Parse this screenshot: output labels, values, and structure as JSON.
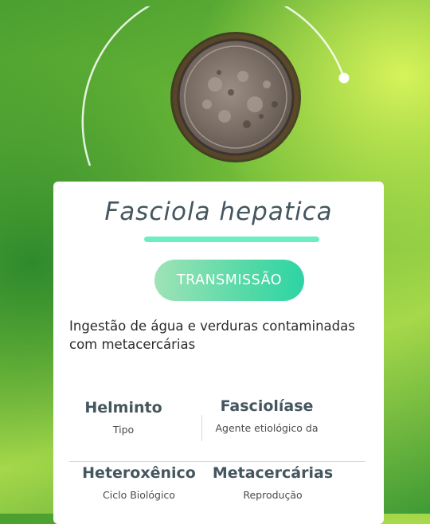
{
  "specimen": {
    "image": "fasciola-egg-micrograph"
  },
  "card": {
    "title": "Fasciola hepatica",
    "button_label": "TRANSMISSÃO",
    "description": "Ingestão de água e verduras contaminadas com metacercárias",
    "stats": [
      {
        "value": "Helminto",
        "label": "Tipo"
      },
      {
        "value": "Fasciolíase",
        "label": "Agente etiológico  da"
      },
      {
        "value": "Heteroxênico",
        "label": "Ciclo Biológico"
      },
      {
        "value": "Metacercárias",
        "label": "Reprodução"
      }
    ]
  },
  "colors": {
    "accent": "#6cefc0",
    "button_start": "#9fe3b7",
    "button_end": "#2dd4a4",
    "title_text": "#44565e"
  }
}
